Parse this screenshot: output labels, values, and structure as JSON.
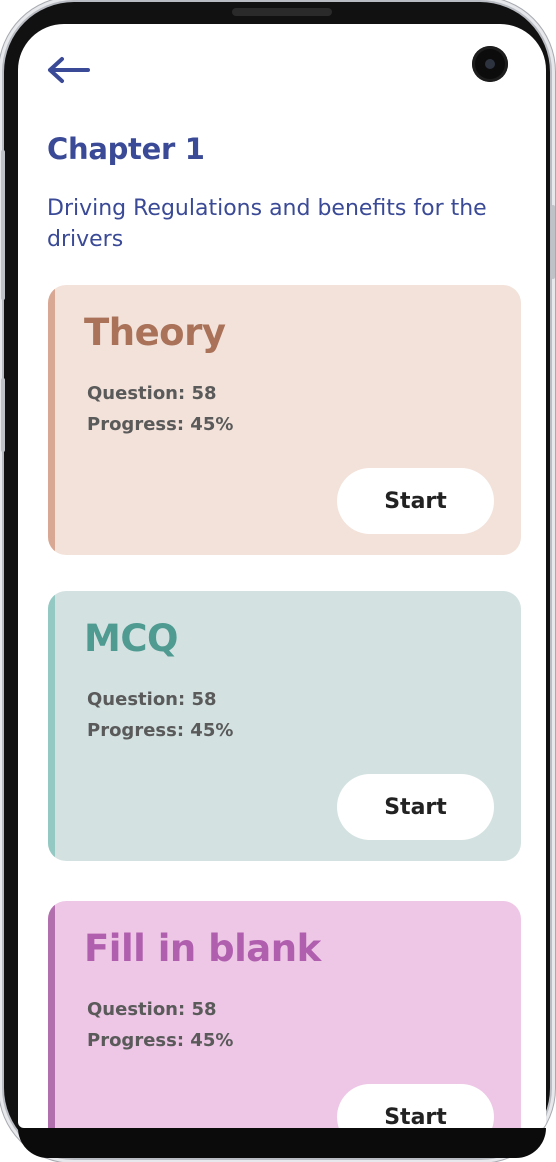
{
  "header": {
    "back_icon": "arrow-left-icon",
    "camera_icon": "front-camera-icon"
  },
  "chapter": {
    "title": "Chapter 1",
    "subtitle": "Driving Regulations and benefits for the drivers"
  },
  "cards": [
    {
      "title": "Theory",
      "question_text": "Question: 58",
      "progress_text": "Progress: 45%",
      "button_label": "Start",
      "background": "#f2e2da",
      "accent": "#d9a894",
      "title_color": "#a97259"
    },
    {
      "title": "MCQ",
      "question_text": "Question: 58",
      "progress_text": "Progress: 45%",
      "button_label": "Start",
      "background": "#d3e2e1",
      "accent": "#93c9c2",
      "title_color": "#4f9a91"
    },
    {
      "title": "Fill in blank",
      "question_text": "Question: 58",
      "progress_text": "Progress: 45%",
      "button_label": "Start",
      "background": "#eec7e6",
      "accent": "#b16fae",
      "title_color": "#b05faf"
    }
  ],
  "colors": {
    "primary": "#3a4a96",
    "stat_text": "#5a5a5a"
  }
}
